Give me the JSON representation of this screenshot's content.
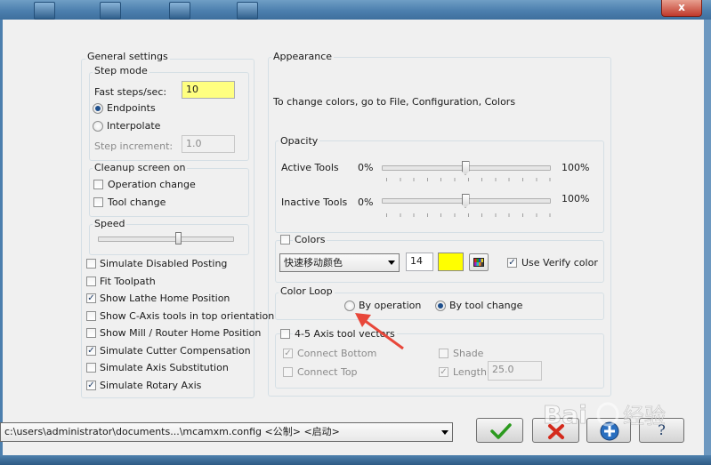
{
  "window": {
    "close_glyph": "x"
  },
  "general": {
    "title": "General settings",
    "step_mode": {
      "title": "Step mode",
      "fast_steps_label": "Fast steps/sec:",
      "fast_steps_value": "10",
      "endpoints_label": "Endpoints",
      "interpolate_label": "Interpolate",
      "step_increment_label": "Step increment:",
      "step_increment_value": "1.0"
    },
    "cleanup": {
      "title": "Cleanup screen on",
      "operation_change": "Operation change",
      "tool_change": "Tool change"
    },
    "speed": {
      "title": "Speed",
      "level": 0.5
    },
    "options": [
      {
        "label": "Simulate Disabled Posting",
        "checked": false
      },
      {
        "label": "Fit Toolpath",
        "checked": false
      },
      {
        "label": "Show Lathe Home Position",
        "checked": true
      },
      {
        "label": "Show C-Axis tools in top orientation",
        "checked": false
      },
      {
        "label": "Show Mill / Router Home Position",
        "checked": false
      },
      {
        "label": "Simulate Cutter Compensation",
        "checked": true
      },
      {
        "label": "Simulate Axis Substitution",
        "checked": false
      },
      {
        "label": "Simulate Rotary Axis",
        "checked": true
      }
    ]
  },
  "appearance": {
    "title": "Appearance",
    "note": "To change colors, go to File, Configuration, Colors",
    "opacity": {
      "title": "Opacity",
      "active_label": "Active Tools",
      "inactive_label": "Inactive Tools",
      "min": "0%",
      "max": "100%",
      "active_level": 0.5,
      "inactive_level": 0.5
    },
    "colors": {
      "title": "Colors",
      "dropdown": "快速移动颜色",
      "number": "14",
      "swatch": "#ffff00",
      "verify_label": "Use Verify color"
    },
    "color_loop": {
      "title": "Color Loop",
      "by_operation": "By operation",
      "by_tool_change": "By tool change"
    },
    "axis45": {
      "title": "4-5 Axis tool vectors",
      "connect_bottom": "Connect Bottom",
      "connect_top": "Connect Top",
      "shade": "Shade",
      "length": "Length",
      "length_value": "25.0"
    }
  },
  "footer": {
    "config_path": "c:\\users\\administrator\\documents...\\mcamxm.config <公制> <启动>",
    "help_glyph": "?"
  },
  "watermark": {
    "text": "Bai经验"
  },
  "colors": {
    "accent_red": "#e8473a",
    "highlight_yellow": "#ffff80",
    "ok_green": "#2b9a1e"
  }
}
